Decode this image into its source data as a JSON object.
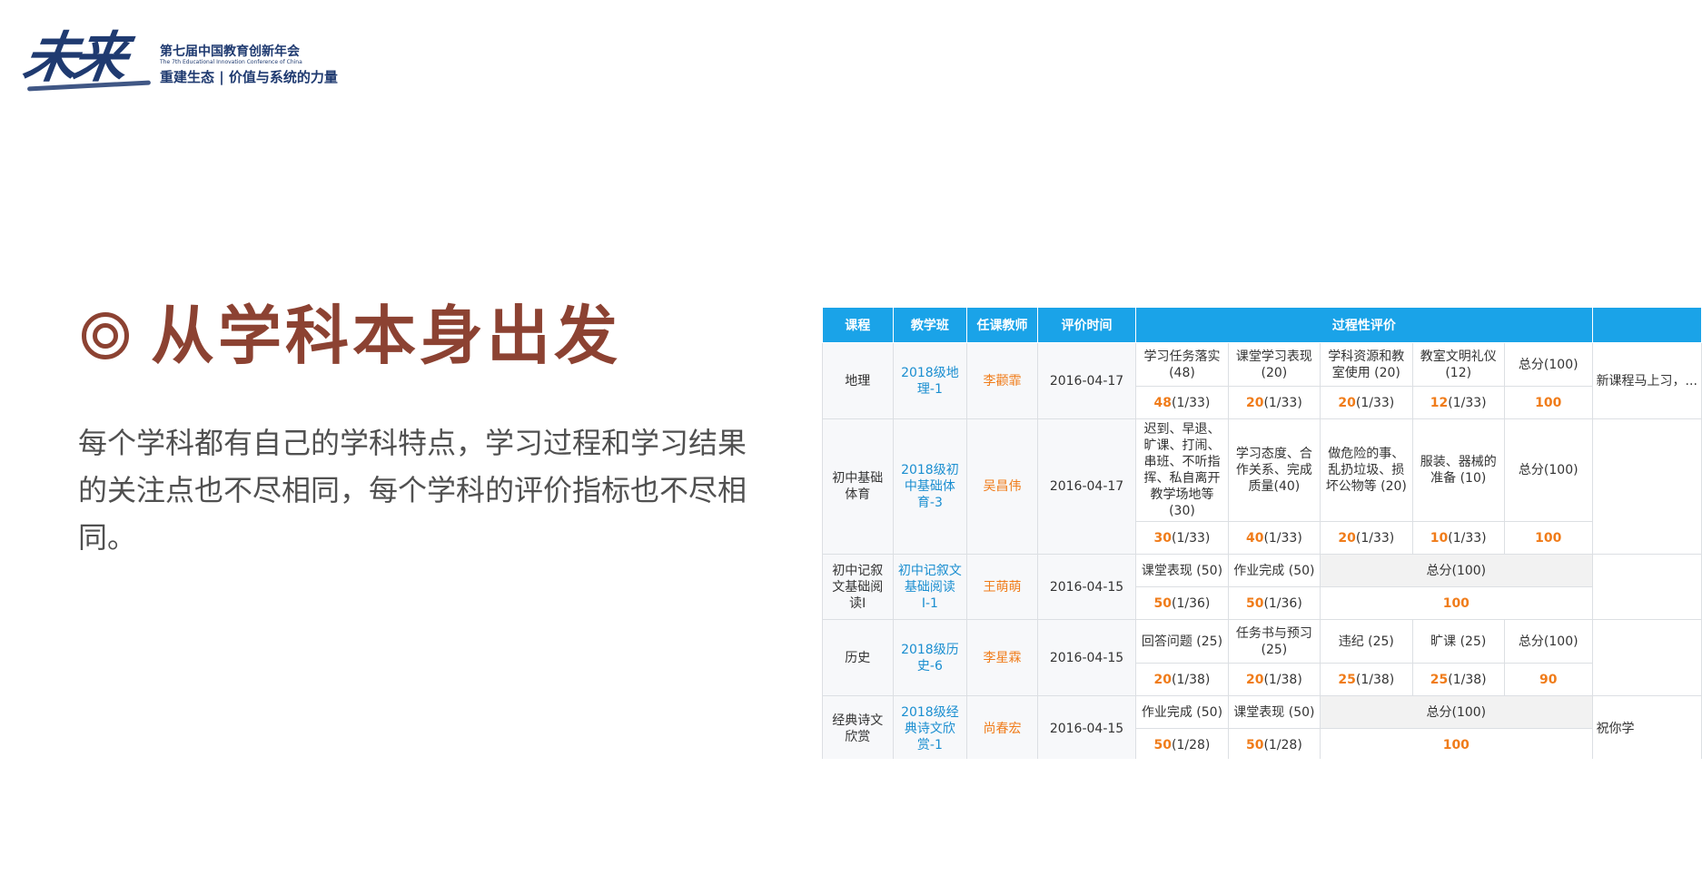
{
  "logo": {
    "mark": "未来",
    "line1": "第七届中国教育创新年会",
    "line2": "The 7th Educational Innovation Conference of China",
    "line3": "重建生态 | 价值与系统的力量"
  },
  "heading": "从学科本身出发",
  "body": "每个学科都有自己的学科特点，学习过程和学习结果的关注点也不尽相同，每个学科的评价指标也不尽相同。",
  "table": {
    "headers": [
      "课程",
      "教学班",
      "任课教师",
      "评价时间",
      "过程性评价"
    ],
    "rows": [
      {
        "course": "地理",
        "class": "2018级地理-1",
        "teacher": "李颧霏",
        "date": "2016-04-17",
        "criteria": [
          "学习任务落实(48)",
          "课堂学习表现(20)",
          "学科资源和教室使用 (20)",
          "教室文明礼仪(12)",
          "总分(100)"
        ],
        "scores": [
          {
            "v": "48",
            "r": "(1/33)"
          },
          {
            "v": "20",
            "r": "(1/33)"
          },
          {
            "v": "20",
            "r": "(1/33)"
          },
          {
            "v": "12",
            "r": "(1/33)"
          }
        ],
        "total": "100",
        "extra": "新课程马上习，..."
      },
      {
        "course": "初中基础体育",
        "class": "2018级初中基础体育-3",
        "teacher": "吴昌伟",
        "date": "2016-04-17",
        "criteria": [
          "迟到、早退、旷课、打闹、串班、不听指挥、私自离开教学场地等 (30)",
          "学习态度、合作关系、完成质量(40)",
          "做危险的事、乱扔垃圾、损坏公物等 (20)",
          "服装、器械的准备 (10)",
          "总分(100)"
        ],
        "scores": [
          {
            "v": "30",
            "r": "(1/33)"
          },
          {
            "v": "40",
            "r": "(1/33)"
          },
          {
            "v": "20",
            "r": "(1/33)"
          },
          {
            "v": "10",
            "r": "(1/33)"
          }
        ],
        "total": "100",
        "extra": ""
      },
      {
        "course": "初中记叙文基础阅读Ⅰ",
        "class": "初中记叙文基础阅读Ⅰ-1",
        "teacher": "王萌萌",
        "date": "2016-04-15",
        "criteria": [
          "课堂表现 (50)",
          "作业完成 (50)",
          "总分(100)"
        ],
        "scores": [
          {
            "v": "50",
            "r": "(1/36)"
          },
          {
            "v": "50",
            "r": "(1/36)"
          }
        ],
        "total": "100",
        "extra": ""
      },
      {
        "course": "历史",
        "class": "2018级历史-6",
        "teacher": "李星霖",
        "date": "2016-04-15",
        "criteria": [
          "回答问题 (25)",
          "任务书与预习(25)",
          "违纪 (25)",
          "旷课 (25)",
          "总分(100)"
        ],
        "scores": [
          {
            "v": "20",
            "r": "(1/38)"
          },
          {
            "v": "20",
            "r": "(1/38)"
          },
          {
            "v": "25",
            "r": "(1/38)"
          },
          {
            "v": "25",
            "r": "(1/38)"
          }
        ],
        "total": "90",
        "extra": ""
      },
      {
        "course": "经典诗文欣赏",
        "class": "2018级经典诗文欣赏-1",
        "teacher": "尚春宏",
        "date": "2016-04-15",
        "criteria": [
          "作业完成 (50)",
          "课堂表现 (50)",
          "总分(100)"
        ],
        "scores": [
          {
            "v": "50",
            "r": "(1/28)"
          },
          {
            "v": "50",
            "r": "(1/28)"
          }
        ],
        "total": "100",
        "extra": "祝你学"
      }
    ]
  }
}
